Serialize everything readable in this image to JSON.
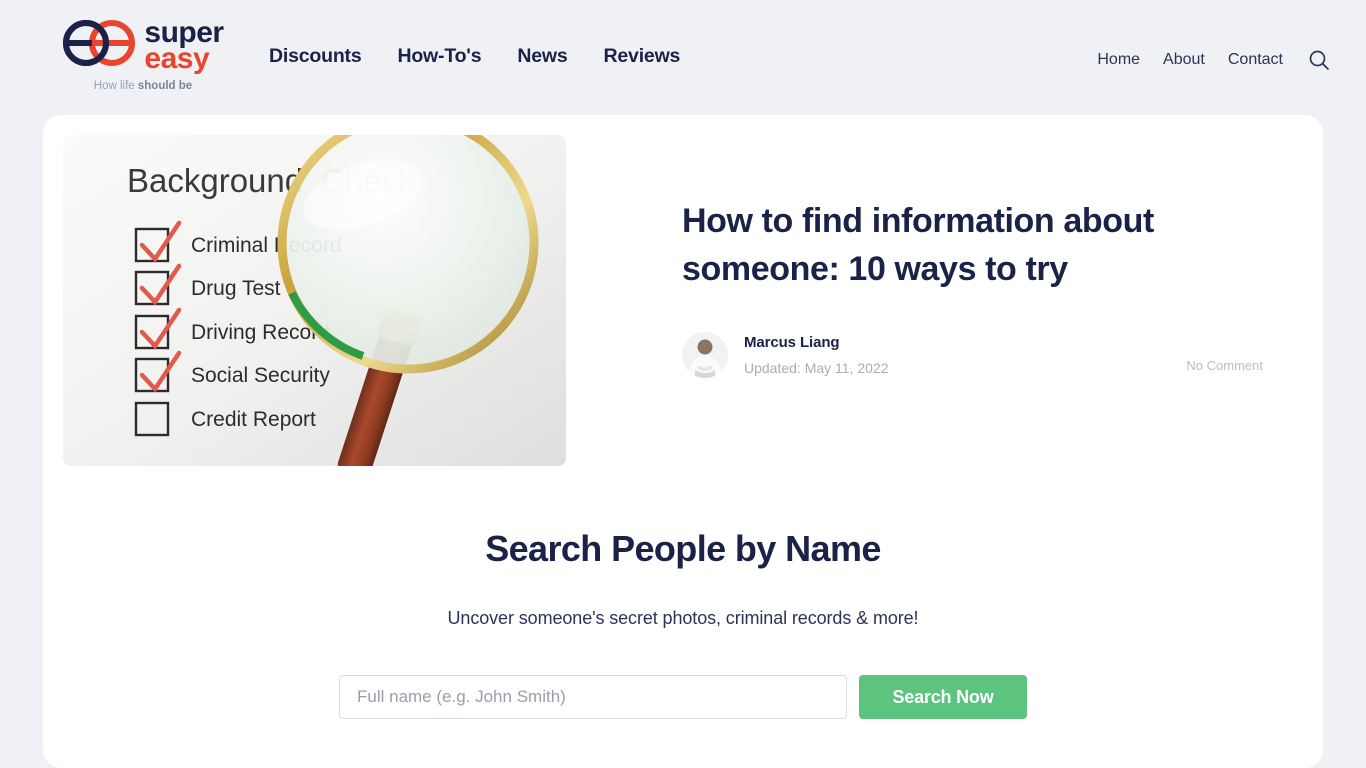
{
  "colors": {
    "page_background": "#f0f1f5",
    "card_background": "#ffffff",
    "brand_navy": "#1b2248",
    "brand_red": "#e8442e",
    "accent_green": "#5cc47e",
    "muted_text": "#a9adbb"
  },
  "header": {
    "brand": {
      "logo_icon": "superreasy-double-e-logo",
      "word_top": "super",
      "word_bottom": "easy",
      "tagline_prefix": "How life ",
      "tagline_bold": "should be"
    },
    "primary_nav": [
      {
        "label": "Discounts"
      },
      {
        "label": "How-To's"
      },
      {
        "label": "News"
      },
      {
        "label": "Reviews"
      }
    ],
    "secondary_nav": [
      {
        "label": "Home"
      },
      {
        "label": "About"
      },
      {
        "label": "Contact"
      }
    ],
    "search_icon": "search-icon"
  },
  "article": {
    "image": {
      "alt": "Background check checklist with magnifying glass",
      "heading": "Background Check",
      "checklist": [
        {
          "label": "Criminal Record",
          "checked": true
        },
        {
          "label": "Drug Test",
          "checked": true
        },
        {
          "label": "Driving Record",
          "checked": true
        },
        {
          "label": "Social Security",
          "checked": true
        },
        {
          "label": "Credit Report",
          "checked": false
        }
      ]
    },
    "title": "How to find information about someone: 10 ways to try",
    "author": {
      "avatar_icon": "author-avatar-photo",
      "name": "Marcus Liang",
      "updated": "Updated: May 11, 2022"
    },
    "comments": "No Comment"
  },
  "search_section": {
    "heading": "Search People by Name",
    "subheading": "Uncover someone's secret photos, criminal records & more!",
    "input_placeholder": "Full name (e.g. John Smith)",
    "input_value": "",
    "button_label": "Search Now"
  }
}
